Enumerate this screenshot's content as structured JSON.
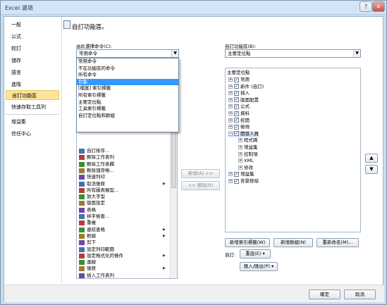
{
  "window": {
    "title": "Excel 選項",
    "help": "?",
    "close": "✕"
  },
  "nav": {
    "items": [
      "一般",
      "公式",
      "校訂",
      "儲存",
      "語言",
      "進階",
      "自訂功能區",
      "快速存取工具列",
      "增益集",
      "信任中心"
    ],
    "selected": "自訂功能區"
  },
  "main": {
    "heading": "自訂功能區。",
    "choose_label": "由此選擇命令(C):",
    "choose_value": "常用命令",
    "customize_label": "自訂功能區(B):",
    "customize_value": "主要定位點"
  },
  "dropdown_options": [
    "常用命令",
    "不在功能區的命令",
    "所有命令",
    "巨集",
    "[檔案] 索引標籤",
    "所有索引標籤",
    "主要定位點",
    "工具索引標籤",
    "自訂定位點和群組"
  ],
  "dropdown_highlight": "巨集",
  "commands": [
    {
      "label": "自訂排序...",
      "icon": "sort-icon"
    },
    {
      "label": "刪除工作表列",
      "icon": "delete-row-icon"
    },
    {
      "label": "刪除工作表欄",
      "icon": "delete-column-icon"
    },
    {
      "label": "刪除儲存格...",
      "icon": "delete-cells-icon"
    },
    {
      "label": "快速列印",
      "icon": "quick-print-icon"
    },
    {
      "label": "取消復原",
      "icon": "undo-icon",
      "submenu": true
    },
    {
      "label": "所有圖表類型...",
      "icon": "chart-icon"
    },
    {
      "label": "放大字型",
      "icon": "font-grow-icon"
    },
    {
      "label": "版面設定",
      "icon": "page-setup-icon"
    },
    {
      "label": "表格",
      "icon": "table-icon"
    },
    {
      "label": "拼字檢查...",
      "icon": "spelling-icon"
    },
    {
      "label": "重複",
      "icon": "redo-icon"
    },
    {
      "label": "連結查格",
      "icon": "link-icon",
      "submenu": true
    },
    {
      "label": "框線",
      "icon": "border-icon",
      "submenu": true
    },
    {
      "label": "剪下",
      "icon": "cut-icon"
    },
    {
      "label": "設定列印範圍",
      "icon": "print-area-icon"
    },
    {
      "label": "設定格式化的條件",
      "icon": "conditional-format-icon",
      "submenu": true
    },
    {
      "label": "連線",
      "icon": "connection-icon"
    },
    {
      "label": "復原",
      "icon": "undo2-icon",
      "submenu": true
    },
    {
      "label": "插入工作表列",
      "icon": "insert-row-icon"
    }
  ],
  "tree_title": "主要定位點",
  "tree": [
    {
      "label": "常用",
      "level": 1,
      "exp": "+",
      "checked": true
    },
    {
      "label": "新件 (自訂)",
      "level": 1,
      "exp": "+",
      "checked": true
    },
    {
      "label": "插入",
      "level": 1,
      "exp": "+",
      "checked": true
    },
    {
      "label": "版面配置",
      "level": 1,
      "exp": "+",
      "checked": true
    },
    {
      "label": "公式",
      "level": 1,
      "exp": "+",
      "checked": true
    },
    {
      "label": "資料",
      "level": 1,
      "exp": "+",
      "checked": true
    },
    {
      "label": "校閱",
      "level": 1,
      "exp": "+",
      "checked": true
    },
    {
      "label": "檢視",
      "level": 1,
      "exp": "+",
      "checked": true
    },
    {
      "label": "開發人員",
      "level": 1,
      "exp": "−",
      "checked": true,
      "selected": true
    },
    {
      "label": "程式碼",
      "level": 2,
      "exp": "+"
    },
    {
      "label": "增益集",
      "level": 2,
      "exp": "+"
    },
    {
      "label": "控制項",
      "level": 2,
      "exp": "+"
    },
    {
      "label": "XML",
      "level": 2,
      "exp": "+"
    },
    {
      "label": "修改",
      "level": 2,
      "exp": "+"
    },
    {
      "label": "增益集",
      "level": 1,
      "exp": "+",
      "checked": true
    },
    {
      "label": "背景移除",
      "level": 1,
      "exp": "+",
      "checked": true
    }
  ],
  "buttons": {
    "add": "新增(A) >>",
    "remove": "<< 移除(R)",
    "new_tab": "新增索引標籤(W)",
    "new_group": "新增群組(N)",
    "rename": "重新命名(M)...",
    "customize_label": "自訂:",
    "reset": "重設(E) ▾",
    "import_export": "匯入/匯出(P) ▾",
    "up": "▲",
    "down": "▼",
    "ok": "確定",
    "cancel": "取消"
  }
}
